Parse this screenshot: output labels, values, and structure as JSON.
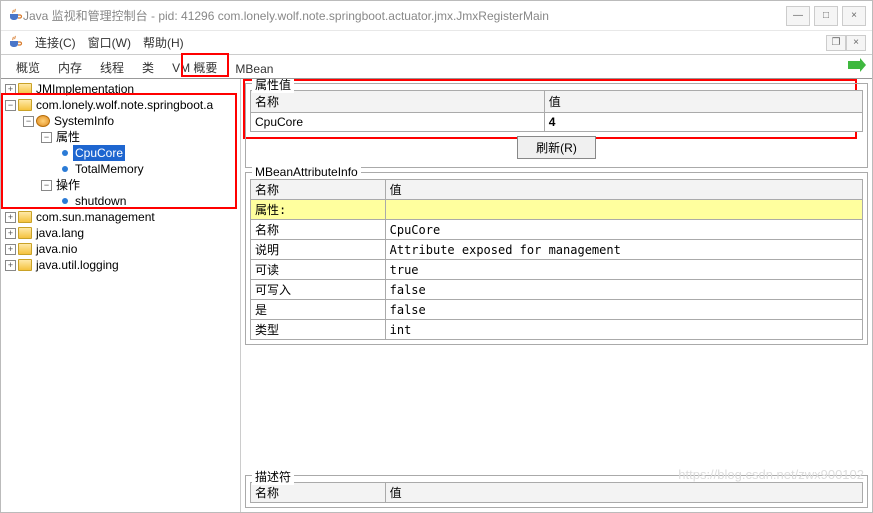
{
  "window": {
    "title": "Java 监视和管理控制台 - pid: 41296 com.lonely.wolf.note.springboot.actuator.jmx.JmxRegisterMain"
  },
  "menu": {
    "connect": "连接(C)",
    "window": "窗口(W)",
    "help": "帮助(H)"
  },
  "tabs": {
    "overview": "概览",
    "memory": "内存",
    "threads": "线程",
    "classes": "类",
    "vm": "VM 概要",
    "mbean": "MBean"
  },
  "tree": {
    "jmimpl": "JMImplementation",
    "pkg": "com.lonely.wolf.note.springboot.a",
    "systeminfo": "SystemInfo",
    "attrs": "属性",
    "cpucore": "CpuCore",
    "totalmem": "TotalMemory",
    "ops": "操作",
    "shutdown": "shutdown",
    "sunmgmt": "com.sun.management",
    "javalang": "java.lang",
    "javanio": "java.nio",
    "javautil": "java.util.logging"
  },
  "attrval": {
    "group": "属性值",
    "name_h": "名称",
    "val_h": "值",
    "name": "CpuCore",
    "val": "4",
    "refresh": "刷新(R)"
  },
  "mbeaninfo": {
    "group": "MBeanAttributeInfo",
    "name_h": "名称",
    "val_h": "值",
    "attr_row": "属性:",
    "r_name_k": "名称",
    "r_name_v": "CpuCore",
    "r_desc_k": "说明",
    "r_desc_v": "Attribute exposed for management",
    "r_read_k": "可读",
    "r_read_v": "true",
    "r_write_k": "可写入",
    "r_write_v": "false",
    "r_is_k": "是",
    "r_is_v": "false",
    "r_type_k": "类型",
    "r_type_v": "int"
  },
  "desc": {
    "group": "描述符",
    "name_h": "名称",
    "val_h": "值"
  },
  "watermark": "https://blog.csdn.net/zwx900102"
}
